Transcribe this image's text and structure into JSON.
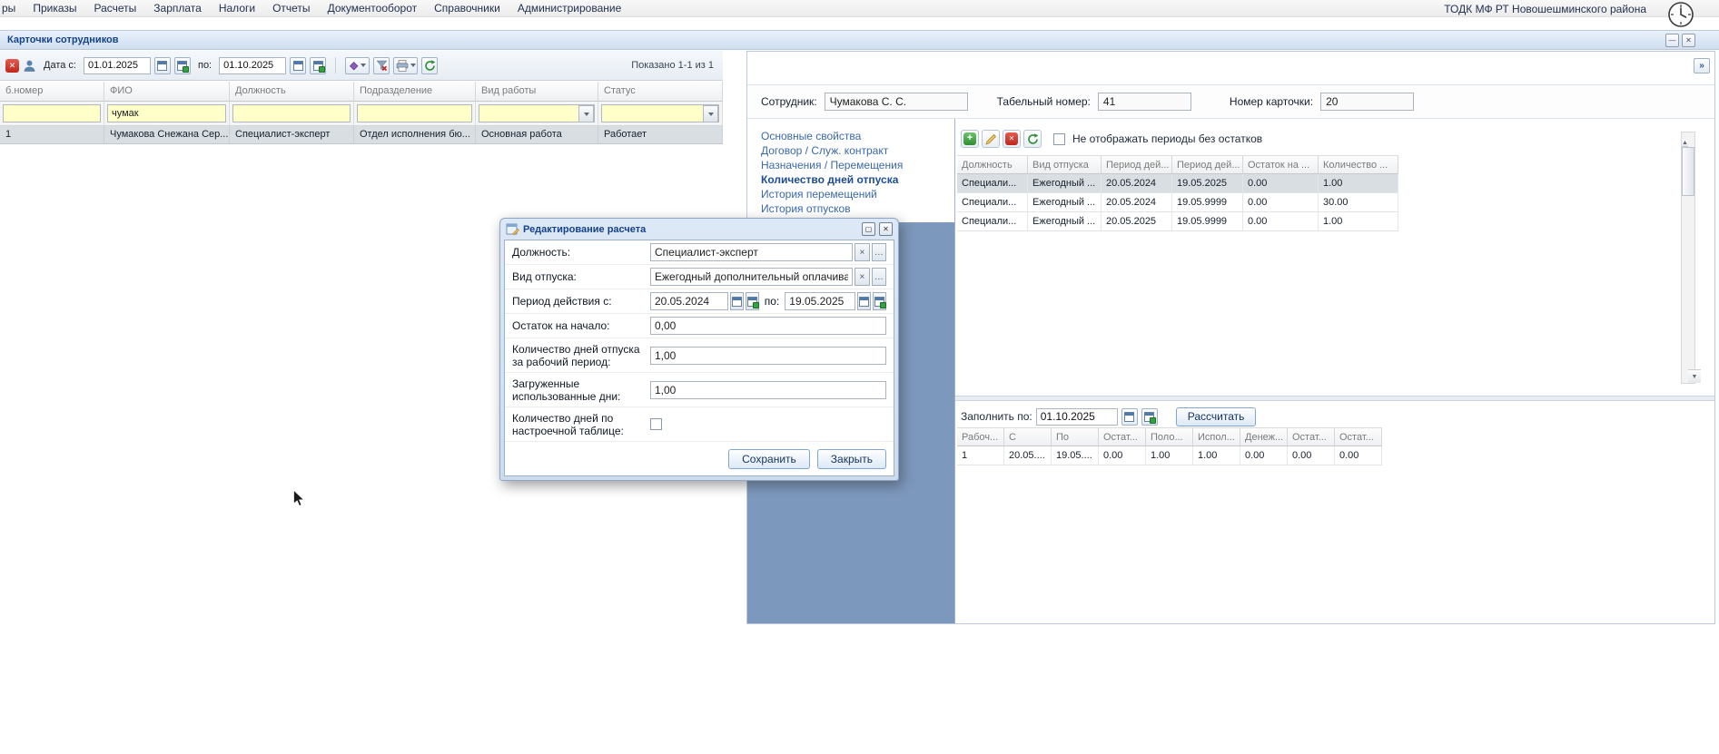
{
  "colors": {
    "accent": "#15428b",
    "panel_blue": "#7d98bd",
    "filter_yellow": "#feffc9",
    "selection": "#d9dee3"
  },
  "menubar": {
    "items": [
      "ры",
      "Приказы",
      "Расчеты",
      "Зарплата",
      "Налоги",
      "Отчеты",
      "Документооборот",
      "Справочники",
      "Администрирование"
    ],
    "org_name": "ТОДК МФ РТ Новошешминского района"
  },
  "window": {
    "title": "Карточки сотрудников"
  },
  "toolbar": {
    "date_from_label": "Дата с:",
    "date_from": "01.01.2025",
    "date_to_label": "по:",
    "date_to": "01.10.2025",
    "paging_status": "Показано 1-1 из 1"
  },
  "employee_grid": {
    "columns": [
      "б.номер",
      "ФИО",
      "Должность",
      "Подразделение",
      "Вид работы",
      "Статус"
    ],
    "filter_fio": "чумак",
    "row": [
      "1",
      "Чумакова Снежана Сер...",
      "Специалист-эксперт",
      "Отдел исполнения бю...",
      "Основная работа",
      "Работает"
    ]
  },
  "employee_panel": {
    "employee_label": "Сотрудник:",
    "employee_value": "Чумакова С. С.",
    "tab_number_label": "Табельный номер:",
    "tab_number_value": "41",
    "card_number_label": "Номер карточки:",
    "card_number_value": "20",
    "nav": [
      "Основные свойства",
      "Договор / Служ. контракт",
      "Назначения / Перемещения",
      "Количество дней отпуска",
      "История перемещений",
      "История отпусков"
    ]
  },
  "vacation_grid": {
    "hide_empty_label": "Не отображать периоды без остатков",
    "columns": [
      "Должность",
      "Вид отпуска",
      "Период дей...",
      "Период дей...",
      "Остаток на ...",
      "Количество ..."
    ],
    "rows": [
      [
        "Специали...",
        "Ежегодный ...",
        "20.05.2024",
        "19.05.2025",
        "0.00",
        "1.00"
      ],
      [
        "Специали...",
        "Ежегодный ...",
        "20.05.2024",
        "19.05.9999",
        "0.00",
        "30.00"
      ],
      [
        "Специали...",
        "Ежегодный ...",
        "20.05.2025",
        "19.05.9999",
        "0.00",
        "1.00"
      ]
    ]
  },
  "calc_panel": {
    "fill_label": "Заполнить по:",
    "fill_date": "01.10.2025",
    "calc_button": "Рассчитать",
    "columns": [
      "Рабоч...",
      "С",
      "По",
      "Остат...",
      "Поло...",
      "Испол...",
      "Денеж...",
      "Остат...",
      "Остат..."
    ],
    "row": [
      "1",
      "20.05....",
      "19.05....",
      "0.00",
      "1.00",
      "1.00",
      "0.00",
      "0.00",
      "0.00"
    ]
  },
  "dialog": {
    "title": "Редактирование расчета",
    "position_label": "Должность:",
    "position_value": "Специалист-эксперт",
    "vacation_type_label": "Вид отпуска:",
    "vacation_type_value": "Ежегодный дополнительный оплачиваем",
    "period_label": "Период действия с:",
    "period_from": "20.05.2024",
    "period_to_label": "по:",
    "period_to": "19.05.2025",
    "balance_label": "Остаток на начало:",
    "balance_value": "0,00",
    "days_label": "Количество дней отпуска за рабочий период:",
    "days_value": "1,00",
    "used_label": "Загруженные использованные дни:",
    "used_value": "1,00",
    "table_days_label": "Количество дней по настроечной таблице:",
    "save_button": "Сохранить",
    "close_button": "Закрыть"
  }
}
